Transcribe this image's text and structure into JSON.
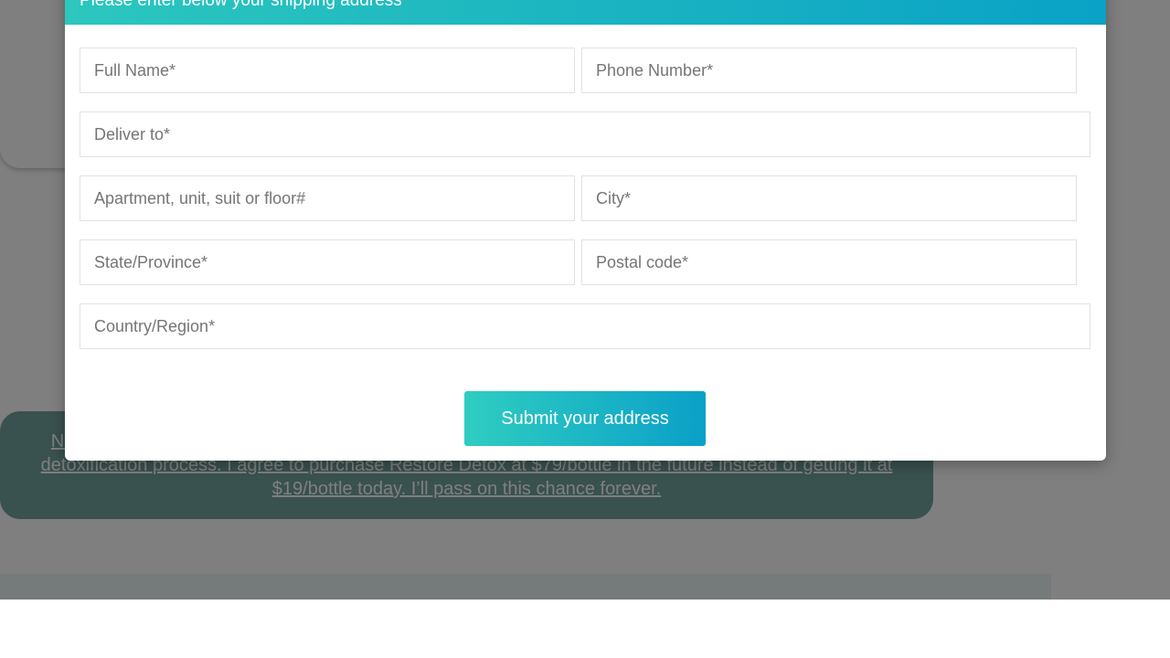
{
  "modal": {
    "title": "Please enter below your shipping address",
    "fields": {
      "full_name": "Full Name*",
      "phone": "Phone Number*",
      "deliver_to": "Deliver to*",
      "apartment": "Apartment, unit, suit or floor#",
      "city": "City*",
      "state": "State/Province*",
      "postal": "Postal code*",
      "country": "Country/Region*"
    },
    "submit_label": "Submit your address"
  },
  "background": {
    "decline_link": "No thanks, I don’t want to take advantage of this one-time exclusive discount. I don’t really want the full detoxification process. I agree to purchase Restore Detox at $79/bottle in the future instead of getting it at $19/bottle today. I’ll pass on this chance forever."
  },
  "colors": {
    "header_gradient_start": "#2cc7bd",
    "header_gradient_end": "#0aa2c6",
    "decline_bg": "#72a29f"
  }
}
